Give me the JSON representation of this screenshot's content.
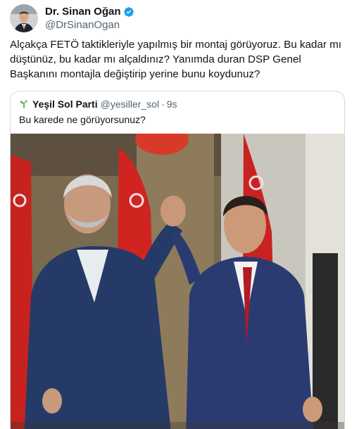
{
  "author": {
    "display_name": "Dr. Sinan Oğan",
    "handle": "@DrSinanOgan",
    "avatar_icon": "profile-photo",
    "verified_icon": "verified-badge-icon",
    "verified_color": "#1d9bf0"
  },
  "tweet": {
    "text": "Alçakça FETÖ taktikleriyle yapılmış bir montaj görüyoruz. Bu kadar mı düştünüz, bu kadar mı alçaldınız? Yanımda duran DSP Genel Başkanını montajla değiştirip yerine bunu koydunuz?"
  },
  "quoted_tweet": {
    "display_name": "Yeşil Sol Parti",
    "handle": "@yesiller_sol",
    "separator": "·",
    "time": "9s",
    "text": "Bu karede ne görüyorsunuz?",
    "avatar_icon": "sprout-logo-icon",
    "photo": "two-men-raising-joined-hands-in-front-of-turkish-flags"
  },
  "colors": {
    "text_primary": "#0f1419",
    "text_secondary": "#536471",
    "border": "#cfd9de",
    "flag_red": "#d21f1f"
  }
}
